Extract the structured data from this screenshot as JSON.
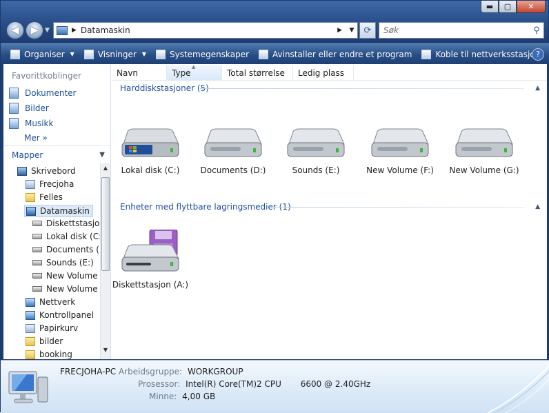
{
  "window": {
    "caption_min": "▬",
    "caption_max": "▢",
    "caption_close": "✕"
  },
  "nav": {
    "back_icon": "◀",
    "forward_icon": "▶",
    "address": "Datamaskin",
    "search_placeholder": "Søk"
  },
  "toolbar": {
    "organise": "Organiser",
    "views": "Visninger",
    "system_properties": "Systemegenskaper",
    "uninstall": "Avinstaller eller endre et program",
    "map_drive": "Koble til nettverksstasjon",
    "more": "»",
    "help": "?"
  },
  "left": {
    "favorites_head": "Favorittkoblinger",
    "favorites": [
      "Dokumenter",
      "Bilder",
      "Musikk"
    ],
    "more": "Mer",
    "more_arrow": "»",
    "folders_head": "Mapper",
    "tree": [
      "Skrivebord",
      "Frecjoha",
      "Felles",
      "Datamaskin",
      "Diskettstasjon",
      "Lokal disk (C:)",
      "Documents (D",
      "Sounds (E:)",
      "New Volume (",
      "New Volume (",
      "Nettverk",
      "Kontrollpanel",
      "Papirkurv",
      "bilder",
      "booking"
    ]
  },
  "columns": [
    "Navn",
    "Type",
    "Total størrelse",
    "Ledig plass"
  ],
  "groups": {
    "hdd_label": "Harddiskstasjoner (5)",
    "removable_label": "Enheter med flyttbare lagringsmedier (1)"
  },
  "drives": [
    "Lokal disk (C:)",
    "Documents (D:)",
    "Sounds (E:)",
    "New Volume (F:)",
    "New Volume (G:)"
  ],
  "removable": [
    "Diskettstasjon (A:)"
  ],
  "details": {
    "computer_name": "FRECJOHA-PC",
    "workgroup_label": "Arbeidsgruppe:",
    "workgroup": "WORKGROUP",
    "processor_label": "Prosessor:",
    "processor": "Intel(R) Core(TM)2 CPU",
    "processor_speed": "6600  @ 2.40GHz",
    "memory_label": "Minne:",
    "memory": "4,00 GB"
  },
  "colors": {
    "link": "#1d4f9a",
    "toolbar": "#274d85",
    "title": "#2a4f8a"
  }
}
